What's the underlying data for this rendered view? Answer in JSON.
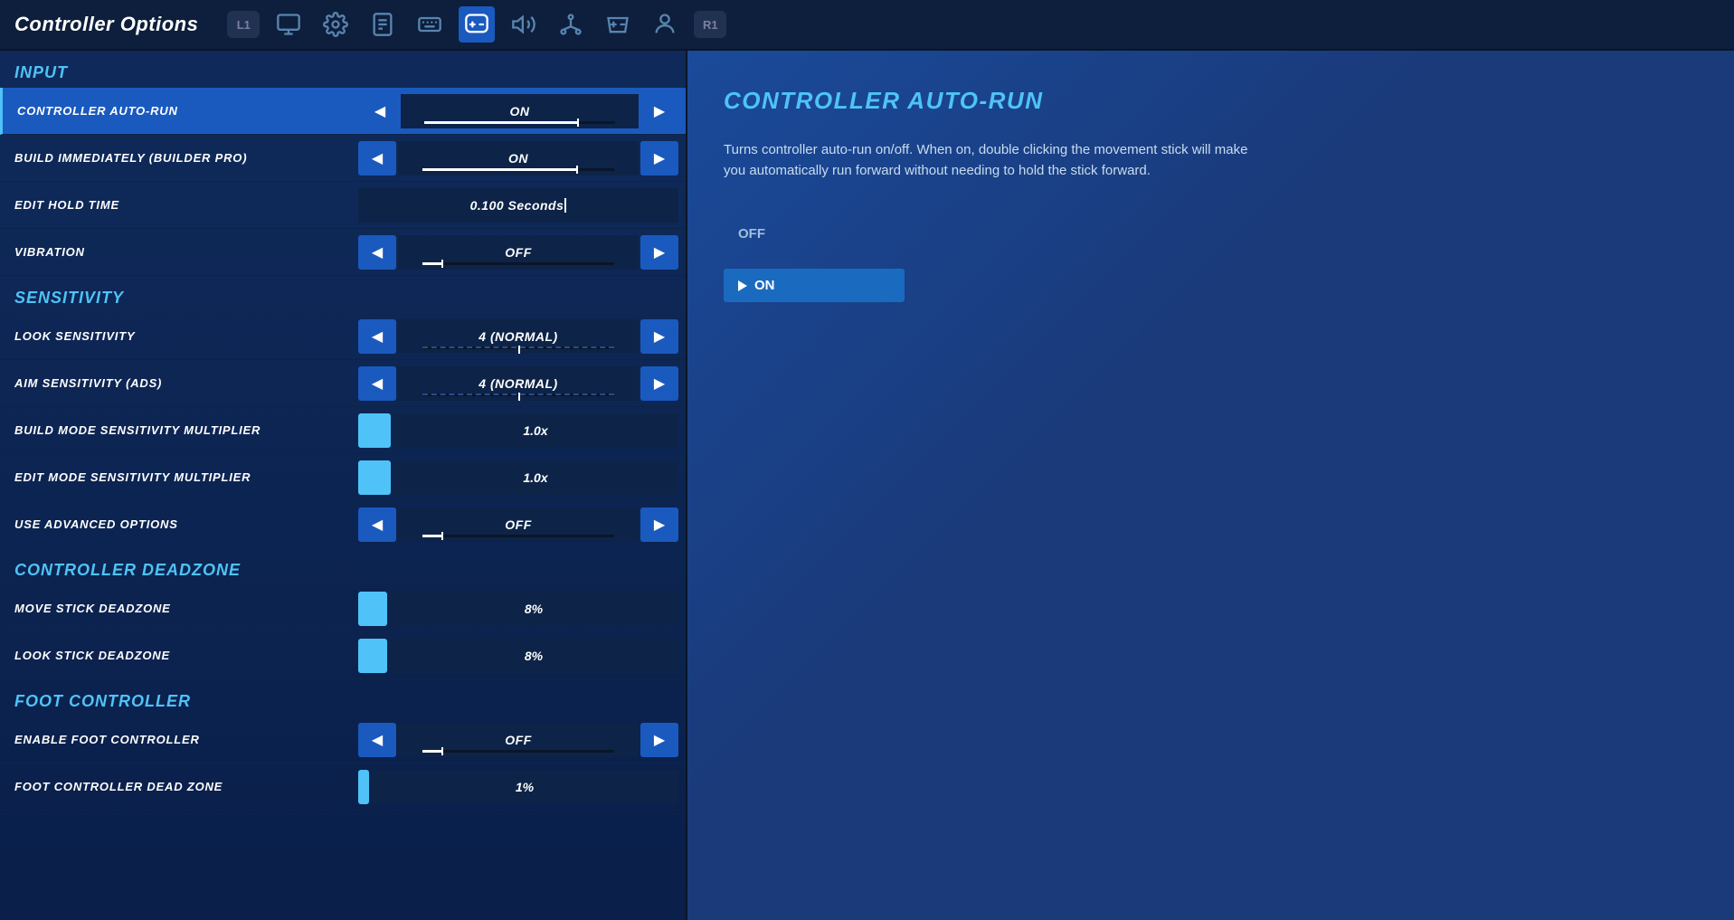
{
  "app": {
    "title": "Controller Options"
  },
  "nav": {
    "icons": [
      {
        "name": "l1-badge",
        "label": "L1",
        "type": "badge"
      },
      {
        "name": "monitor-icon",
        "label": "⬜",
        "active": false
      },
      {
        "name": "gear-icon",
        "label": "⚙",
        "active": false
      },
      {
        "name": "document-icon",
        "label": "🗒",
        "active": false
      },
      {
        "name": "keyboard-icon",
        "label": "⌨",
        "active": false
      },
      {
        "name": "controller-icon",
        "label": "🎮",
        "active": true
      },
      {
        "name": "speaker-icon",
        "label": "🔊",
        "active": false
      },
      {
        "name": "network-icon",
        "label": "🌐",
        "active": false
      },
      {
        "name": "gamepad-icon",
        "label": "🎮",
        "active": false
      },
      {
        "name": "person-icon",
        "label": "👤",
        "active": false
      },
      {
        "name": "r1-badge",
        "label": "R1",
        "type": "badge"
      }
    ]
  },
  "sections": [
    {
      "id": "input",
      "label": "INPUT",
      "rows": [
        {
          "id": "controller-auto-run",
          "label": "CONTROLLER AUTO-RUN",
          "type": "toggle",
          "value": "ON",
          "selected": true,
          "show_arrows": true,
          "slider_pct": 80
        },
        {
          "id": "build-immediately",
          "label": "BUILD IMMEDIATELY (BUILDER PRO)",
          "type": "toggle",
          "value": "ON",
          "selected": false,
          "show_arrows": true,
          "slider_pct": 80
        },
        {
          "id": "edit-hold-time",
          "label": "EDIT HOLD TIME",
          "type": "text_input",
          "value": "0.100 Seconds",
          "selected": false,
          "show_arrows": false
        },
        {
          "id": "vibration",
          "label": "VIBRATION",
          "type": "toggle",
          "value": "OFF",
          "selected": false,
          "show_arrows": true,
          "slider_pct": 10
        }
      ]
    },
    {
      "id": "sensitivity",
      "label": "SENSITIVITY",
      "rows": [
        {
          "id": "look-sensitivity",
          "label": "LOOK SENSITIVITY",
          "type": "toggle",
          "value": "4 (NORMAL)",
          "selected": false,
          "show_arrows": true,
          "slider_pct": 50,
          "dashed": true
        },
        {
          "id": "aim-sensitivity",
          "label": "AIM SENSITIVITY (ADS)",
          "type": "toggle",
          "value": "4 (NORMAL)",
          "selected": false,
          "show_arrows": true,
          "slider_pct": 50,
          "dashed": true
        },
        {
          "id": "build-mode-sensitivity",
          "label": "BUILD MODE SENSITIVITY MULTIPLIER",
          "type": "slider_left",
          "value": "1.0x",
          "selected": false,
          "show_arrows": false,
          "slider_color": "#4fc3f7"
        },
        {
          "id": "edit-mode-sensitivity",
          "label": "EDIT MODE SENSITIVITY MULTIPLIER",
          "type": "slider_left",
          "value": "1.0x",
          "selected": false,
          "show_arrows": false,
          "slider_color": "#4fc3f7"
        },
        {
          "id": "use-advanced-options",
          "label": "USE ADVANCED OPTIONS",
          "type": "toggle",
          "value": "OFF",
          "selected": false,
          "show_arrows": true,
          "slider_pct": 10
        }
      ]
    },
    {
      "id": "controller-deadzone",
      "label": "CONTROLLER DEADZONE",
      "rows": [
        {
          "id": "move-stick-deadzone",
          "label": "MOVE STICK DEADZONE",
          "type": "slider_left",
          "value": "8%",
          "selected": false,
          "show_arrows": false,
          "slider_color": "#4fc3f7"
        },
        {
          "id": "look-stick-deadzone",
          "label": "LOOK STICK DEADZONE",
          "type": "slider_left",
          "value": "8%",
          "selected": false,
          "show_arrows": false,
          "slider_color": "#4fc3f7"
        }
      ]
    },
    {
      "id": "foot-controller",
      "label": "FOOT CONTROLLER",
      "rows": [
        {
          "id": "enable-foot-controller",
          "label": "ENABLE FOOT CONTROLLER",
          "type": "toggle",
          "value": "OFF",
          "selected": false,
          "show_arrows": true,
          "slider_pct": 10
        },
        {
          "id": "foot-controller-dead-zone",
          "label": "FOOT CONTROLLER DEAD ZONE",
          "type": "slider_left",
          "value": "1%",
          "selected": false,
          "show_arrows": false,
          "slider_color": "#4fc3f7"
        }
      ]
    }
  ],
  "detail": {
    "title": "CONTROLLER AUTO-RUN",
    "description": "Turns controller auto-run on/off. When on, double clicking the movement stick will make you automatically run forward without needing to hold the stick forward.",
    "options": [
      {
        "label": "OFF",
        "selected": false
      },
      {
        "label": "ON",
        "selected": true
      }
    ]
  },
  "colors": {
    "accent": "#4fc3f7",
    "selected_bg": "#1a5abf",
    "panel_bg": "#0f2a5a",
    "value_bg": "#0d2448",
    "nav_active": "#1a5abf",
    "slider_fill": "#4fc3f7"
  }
}
